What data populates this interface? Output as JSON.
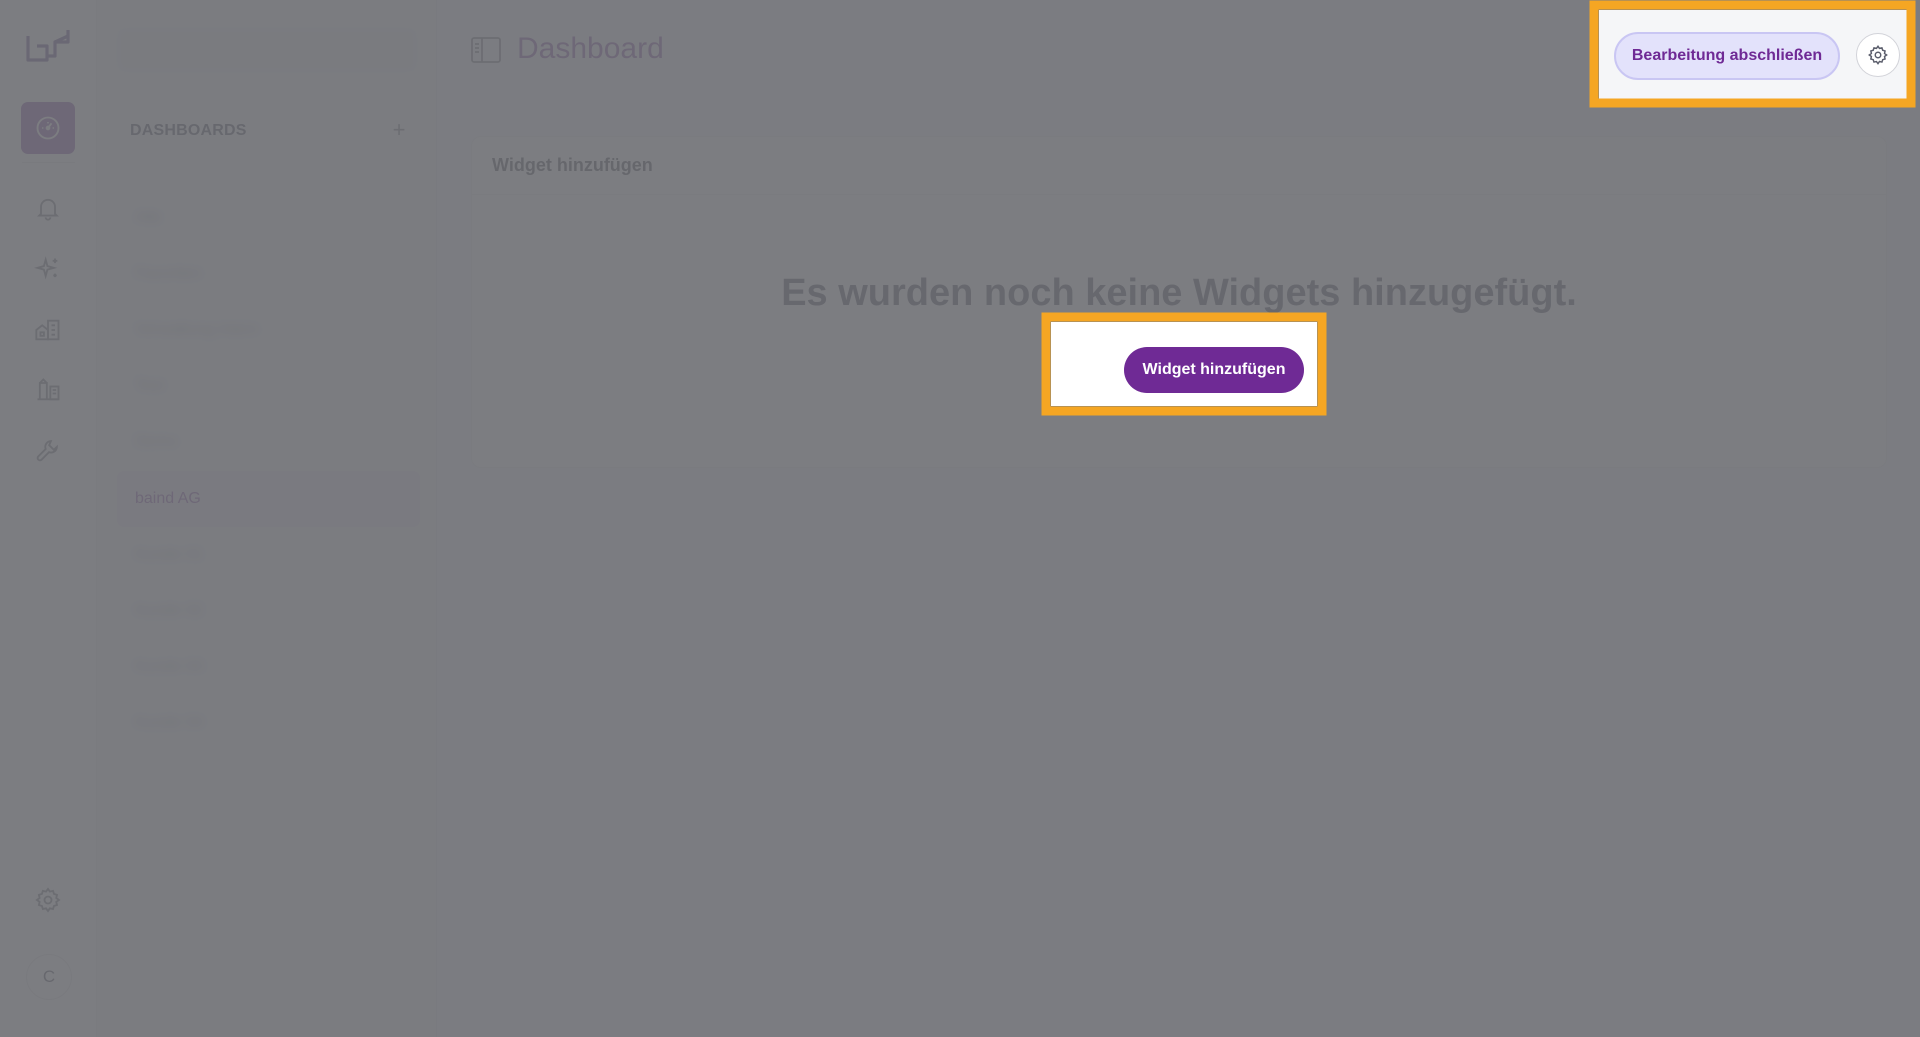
{
  "rail": {
    "avatar_initial": "C",
    "icons": [
      "logo-icon",
      "dashboard-icon",
      "bell-icon",
      "sparkles-icon",
      "buildings-icon",
      "lab-icon",
      "wrench-icon",
      "gear-icon"
    ]
  },
  "sidebar": {
    "section_title": "DASHBOARDS",
    "add_label": "+",
    "items": [
      {
        "label": "Alle",
        "blurred": true
      },
      {
        "label": "Favoriten",
        "blurred": true
      },
      {
        "label": "Verwaltung intern",
        "blurred": true
      },
      {
        "label": "Test",
        "blurred": true
      },
      {
        "label": "Demo",
        "blurred": true
      },
      {
        "label": "baind AG",
        "blurred": false,
        "active": true
      },
      {
        "label": "Kunde 01",
        "blurred": true
      },
      {
        "label": "Kunde 02",
        "blurred": true
      },
      {
        "label": "Kunde 03",
        "blurred": true
      },
      {
        "label": "Kunde 04",
        "blurred": true
      }
    ]
  },
  "header": {
    "title": "Dashboard",
    "finish_editing_label": "Bearbeitung abschließen"
  },
  "card": {
    "header_label": "Widget hinzufügen",
    "empty_text": "Es wurden noch keine Widgets hinzugefügt.",
    "add_button_label": "Widget hinzufügen"
  },
  "colors": {
    "brand": "#6f2a95",
    "highlight": "#f5a623",
    "overlay": "#6e6f73"
  }
}
